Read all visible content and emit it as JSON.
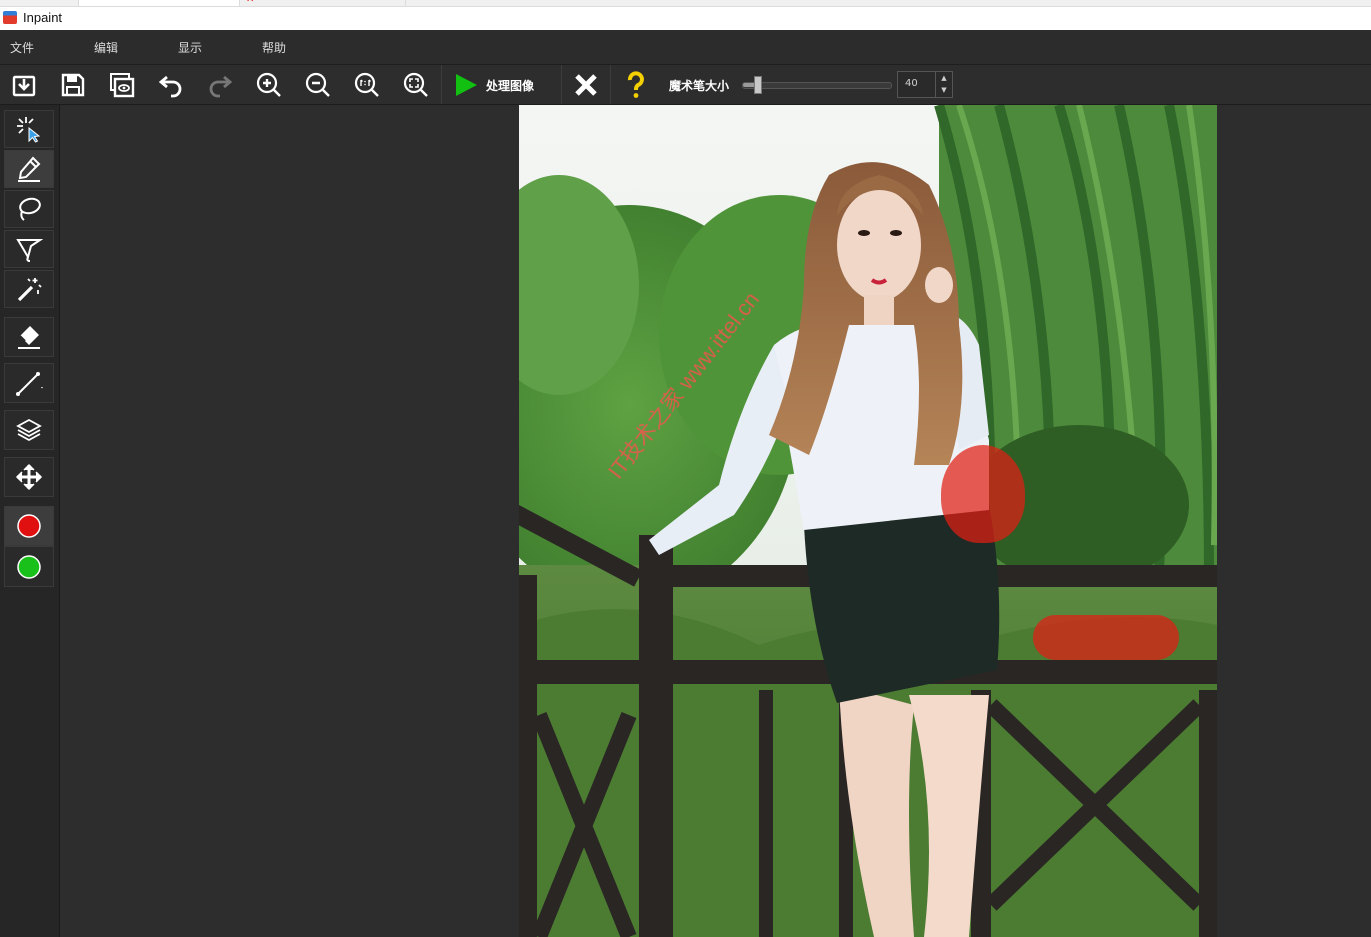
{
  "window": {
    "title": "Inpaint"
  },
  "menu": {
    "file": "文件",
    "edit": "编辑",
    "view": "显示",
    "help": "帮助"
  },
  "toolbar": {
    "process_label": "处理图像",
    "brush_size_label": "魔术笔大小",
    "brush_size_value": "40",
    "brush_size_level": 0.1
  },
  "sidebar": {
    "tools": [
      "smart-select",
      "marker",
      "lasso",
      "polygonal-lasso",
      "magic-wand",
      "eraser",
      "guide-line",
      "layers",
      "move"
    ],
    "colors": [
      "#e01010",
      "#19c019"
    ]
  },
  "canvas": {
    "watermark": "IT技术之家 www.ittel.cn"
  },
  "colors": {
    "background": "#2b2b2b",
    "mask": "#e01e14",
    "process_green": "#11c011",
    "help_yellow": "#f5d000"
  }
}
